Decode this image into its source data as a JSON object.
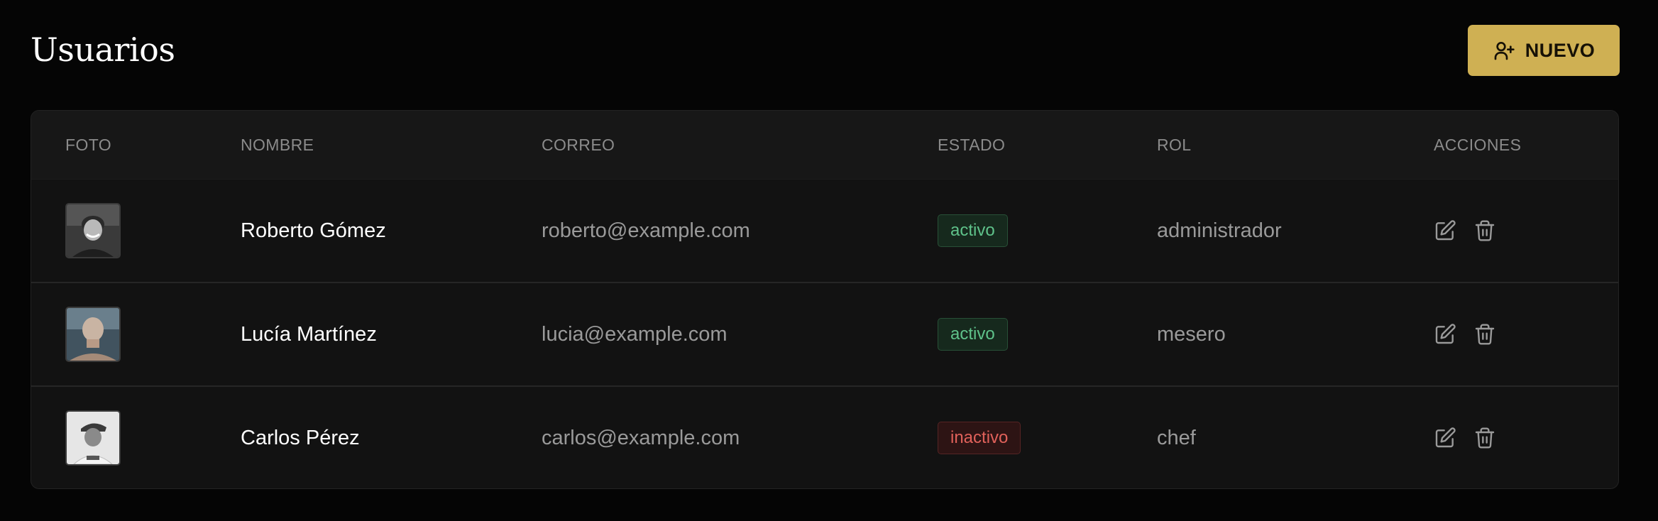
{
  "header": {
    "title": "Usuarios",
    "new_button_label": "NUEVO",
    "new_button_icon": "user-plus-icon"
  },
  "colors": {
    "background": "#050505",
    "accent": "#cfb053",
    "active_status": "#5fc28a",
    "inactive_status": "#e0615a"
  },
  "table": {
    "columns": [
      "FOTO",
      "NOMBRE",
      "CORREO",
      "ESTADO",
      "ROL",
      "ACCIONES"
    ],
    "rows": [
      {
        "name": "Roberto Gómez",
        "email": "roberto@example.com",
        "status": "activo",
        "role": "administrador"
      },
      {
        "name": "Lucía Martínez",
        "email": "lucia@example.com",
        "status": "activo",
        "role": "mesero"
      },
      {
        "name": "Carlos Pérez",
        "email": "carlos@example.com",
        "status": "inactivo",
        "role": "chef"
      }
    ],
    "row_action_icons": [
      "edit-icon",
      "trash-icon"
    ]
  }
}
